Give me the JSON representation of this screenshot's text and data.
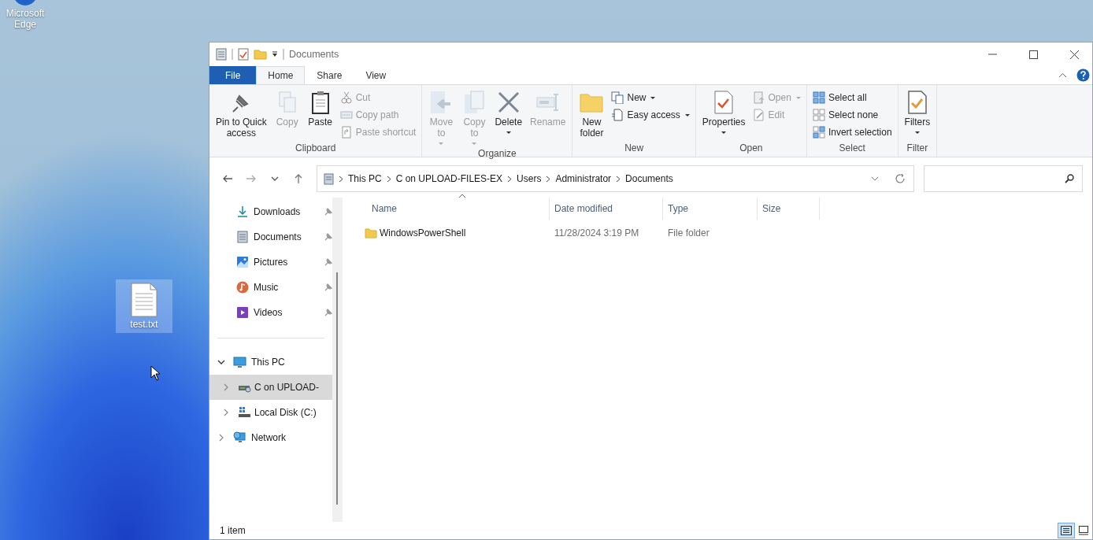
{
  "desktop": {
    "icons": [
      {
        "label": "Microsoft Edge",
        "kind": "browser",
        "selected": false
      },
      {
        "label": "test.txt",
        "kind": "text_file",
        "selected": true
      }
    ]
  },
  "window": {
    "title": "Documents"
  },
  "ribbon_tabs": [
    {
      "label": "File",
      "kind": "file",
      "selected": false
    },
    {
      "label": "Home",
      "kind": "tab",
      "selected": true
    },
    {
      "label": "Share",
      "kind": "tab",
      "selected": false
    },
    {
      "label": "View",
      "kind": "tab",
      "selected": false
    }
  ],
  "ribbon_groups": [
    {
      "label": "Clipboard",
      "commands": [
        {
          "label": "Pin to Quick\naccess",
          "kind": "large",
          "disabled": false,
          "dropdown": false
        },
        {
          "label": "Copy",
          "kind": "large",
          "disabled": true,
          "dropdown": false
        },
        {
          "label": "Paste",
          "kind": "large",
          "disabled": false,
          "dropdown": false
        },
        {
          "label": "Cut",
          "kind": "small",
          "disabled": true,
          "dropdown": false
        },
        {
          "label": "Copy path",
          "kind": "small",
          "disabled": true,
          "dropdown": false
        },
        {
          "label": "Paste shortcut",
          "kind": "small",
          "disabled": true,
          "dropdown": false
        }
      ]
    },
    {
      "label": "Organize",
      "commands": [
        {
          "label": "Move\nto",
          "kind": "large",
          "disabled": true,
          "dropdown": true
        },
        {
          "label": "Copy\nto",
          "kind": "large",
          "disabled": true,
          "dropdown": true
        },
        {
          "label": "Delete",
          "kind": "large",
          "disabled": false,
          "dropdown": true
        },
        {
          "label": "Rename",
          "kind": "large",
          "disabled": true,
          "dropdown": false
        }
      ]
    },
    {
      "label": "New",
      "commands": [
        {
          "label": "New\nfolder",
          "kind": "large",
          "disabled": false,
          "dropdown": false
        },
        {
          "label": "New",
          "kind": "small",
          "disabled": false,
          "dropdown": true
        },
        {
          "label": "Easy access",
          "kind": "small",
          "disabled": false,
          "dropdown": true
        }
      ]
    },
    {
      "label": "Open",
      "commands": [
        {
          "label": "Properties",
          "kind": "large",
          "disabled": false,
          "dropdown": true
        },
        {
          "label": "Open",
          "kind": "small",
          "disabled": true,
          "dropdown": true
        },
        {
          "label": "Edit",
          "kind": "small",
          "disabled": true,
          "dropdown": false
        }
      ]
    },
    {
      "label": "Select",
      "commands": [
        {
          "label": "Select all",
          "kind": "small",
          "disabled": false,
          "dropdown": false
        },
        {
          "label": "Select none",
          "kind": "small",
          "disabled": false,
          "dropdown": false
        },
        {
          "label": "Invert selection",
          "kind": "small",
          "disabled": false,
          "dropdown": false
        }
      ]
    },
    {
      "label": "Filter",
      "commands": [
        {
          "label": "Filters",
          "kind": "large",
          "disabled": false,
          "dropdown": true
        }
      ]
    }
  ],
  "address_bar": {
    "breadcrumbs": [
      "This PC",
      "C on UPLOAD-FILES-EX",
      "Users",
      "Administrator",
      "Documents"
    ]
  },
  "navigation_pane": {
    "quick_access": [
      {
        "label": "Downloads",
        "pinned": true
      },
      {
        "label": "Documents",
        "pinned": true
      },
      {
        "label": "Pictures",
        "pinned": true
      },
      {
        "label": "Music",
        "pinned": true
      },
      {
        "label": "Videos",
        "pinned": true
      }
    ],
    "tree": [
      {
        "label": "This PC",
        "expanded": true,
        "selected": false,
        "children": [
          {
            "label": "C on UPLOAD-",
            "expanded": false,
            "selected": true
          },
          {
            "label": "Local Disk (C:)",
            "expanded": false,
            "selected": false
          }
        ]
      },
      {
        "label": "Network",
        "expanded": false,
        "selected": false
      }
    ]
  },
  "file_list": {
    "columns": [
      {
        "label": "Name",
        "sorted": true
      },
      {
        "label": "Date modified",
        "sorted": false
      },
      {
        "label": "Type",
        "sorted": false
      },
      {
        "label": "Size",
        "sorted": false
      }
    ],
    "rows": [
      {
        "name": "WindowsPowerShell",
        "date_modified": "11/28/2024 3:19 PM",
        "type": "File folder"
      }
    ]
  },
  "status_bar": {
    "item_count": "1 item",
    "views": [
      {
        "kind": "details",
        "selected": true
      },
      {
        "kind": "large_icons",
        "selected": false
      }
    ]
  }
}
